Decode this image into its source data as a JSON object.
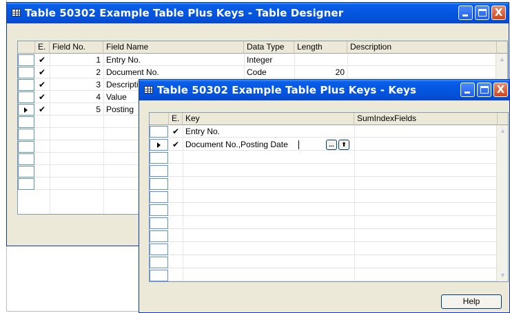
{
  "designer": {
    "title": "Table 50302 Example Table Plus Keys - Table Designer",
    "columns": [
      "E.",
      "Field No.",
      "Field Name",
      "Data Type",
      "Length",
      "Description"
    ],
    "rows": [
      {
        "enabled": "✔",
        "field_no": "1",
        "field_name": "Entry No.",
        "data_type": "Integer",
        "length": "",
        "description": ""
      },
      {
        "enabled": "✔",
        "field_no": "2",
        "field_name": "Document No.",
        "data_type": "Code",
        "length": "20",
        "description": ""
      },
      {
        "enabled": "✔",
        "field_no": "3",
        "field_name": "Description",
        "data_type": "",
        "length": "",
        "description": ""
      },
      {
        "enabled": "✔",
        "field_no": "4",
        "field_name": "Value",
        "data_type": "",
        "length": "",
        "description": ""
      },
      {
        "enabled": "✔",
        "field_no": "5",
        "field_name": "Posting",
        "data_type": "",
        "length": "",
        "description": ""
      }
    ]
  },
  "keys": {
    "title": "Table 50302 Example Table Plus Keys - Keys",
    "columns": [
      "E.",
      "Key",
      "SumIndexFields"
    ],
    "rows": [
      {
        "enabled": "✔",
        "key": "Entry No.",
        "sum_index_fields": ""
      },
      {
        "enabled": "✔",
        "key": "Document No.,Posting Date",
        "sum_index_fields": ""
      }
    ],
    "help_label": "Help",
    "assist_button_label": "...",
    "lookup_button_label": "⬆"
  },
  "title_buttons": {
    "minimize": "",
    "maximize": "",
    "close": "X"
  },
  "colors": {
    "titlebar": "#0556e0",
    "window_bg": "#ece9d8",
    "close": "#d2451d"
  }
}
